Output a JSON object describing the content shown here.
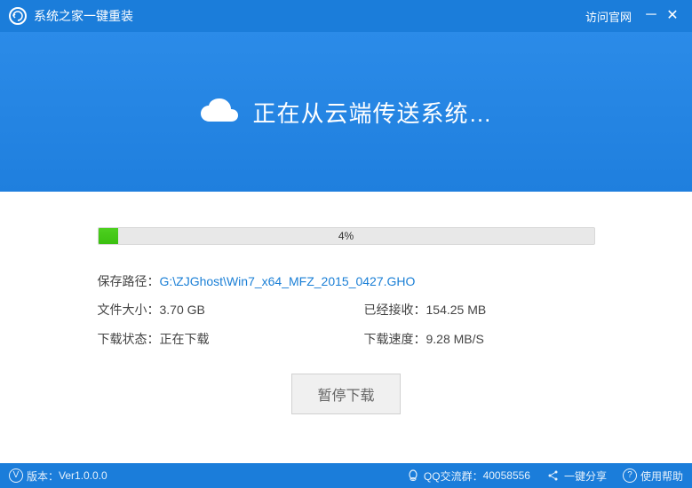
{
  "titlebar": {
    "title": "系统之家一键重装",
    "visit_site": "访问官网"
  },
  "banner": {
    "title": "正在从云端传送系统…"
  },
  "progress": {
    "percent": 4,
    "label": "4%"
  },
  "info": {
    "save_path_label": "保存路径：",
    "save_path_value": "G:\\ZJGhost\\Win7_x64_MFZ_2015_0427.GHO",
    "file_size_label": "文件大小：",
    "file_size_value": "3.70 GB",
    "received_label": "已经接收：",
    "received_value": "154.25 MB",
    "status_label": "下载状态：",
    "status_value": "正在下载",
    "speed_label": "下载速度：",
    "speed_value": "9.28 MB/S"
  },
  "buttons": {
    "pause": "暂停下载"
  },
  "statusbar": {
    "version_label": "版本：",
    "version_value": "Ver1.0.0.0",
    "qq_group_label": "QQ交流群：",
    "qq_group_value": "40058556",
    "share": "一键分享",
    "help": "使用帮助"
  },
  "colors": {
    "primary": "#1b7dda",
    "progress_fill": "#3bc010",
    "link": "#1a7fd6"
  }
}
